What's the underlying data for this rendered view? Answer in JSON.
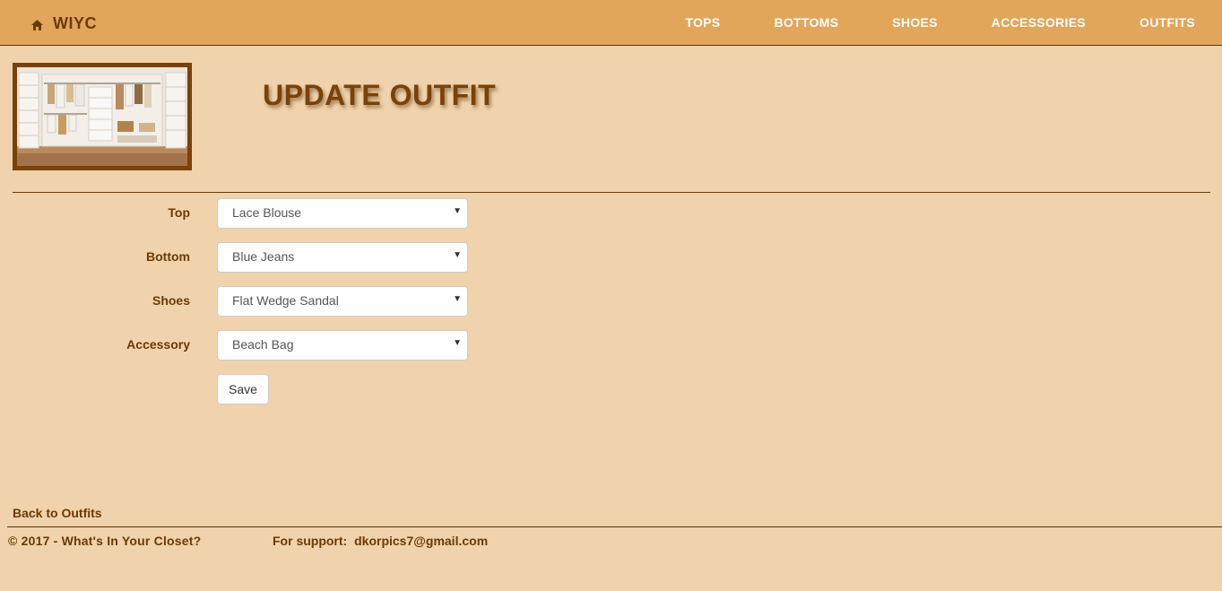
{
  "navbar": {
    "brand": "WIYC",
    "brand_icon": "home-icon",
    "links": [
      "TOPS",
      "BOTTOMS",
      "SHOES",
      "ACCESSORIES",
      "OUTFITS"
    ]
  },
  "page": {
    "title": "UPDATE OUTFIT"
  },
  "form": {
    "top": {
      "label": "Top",
      "value": "Lace Blouse"
    },
    "bottom": {
      "label": "Bottom",
      "value": "Blue Jeans"
    },
    "shoes": {
      "label": "Shoes",
      "value": "Flat Wedge Sandal"
    },
    "accessory": {
      "label": "Accessory",
      "value": "Beach Bag"
    },
    "save_label": "Save"
  },
  "back_link": "Back to Outfits",
  "footer": {
    "copyright": "© 2017 - What's In Your Closet?",
    "support_label": "For support:",
    "support_email": "dkorpics7@gmail.com"
  },
  "colors": {
    "navbar_bg": "#e2a65a",
    "page_bg": "#f0d3ac",
    "text_brown": "#6b3a06",
    "title_brown": "#7a4208"
  }
}
